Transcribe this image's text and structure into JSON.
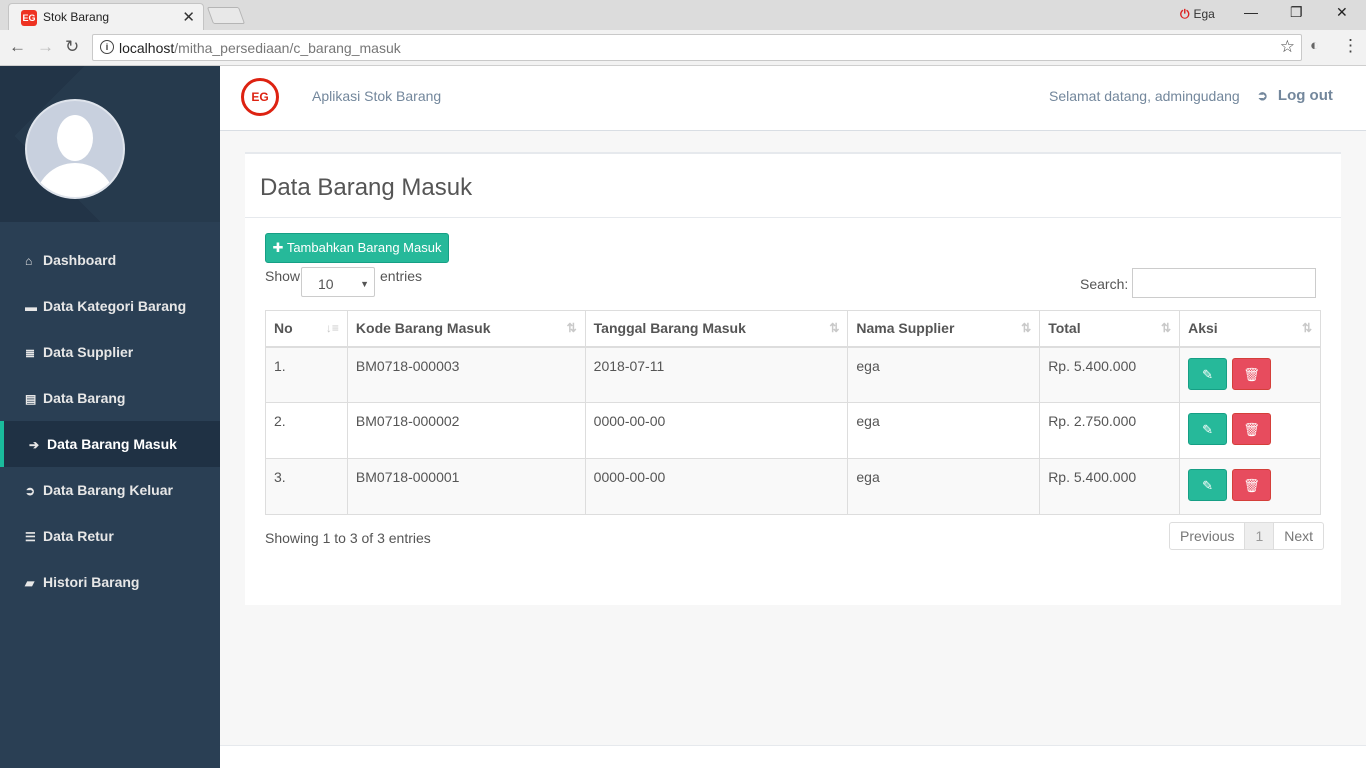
{
  "browser": {
    "tab_title": "Stok Barang",
    "tab_close": "✕",
    "profile_name": "Ega",
    "url_host": "localhost",
    "url_path": "/mitha_persediaan/c_barang_masuk"
  },
  "header": {
    "app_title": "Aplikasi Stok Barang",
    "welcome": "Selamat datang, admingudang",
    "logout_label": "Log out"
  },
  "sidebar": {
    "items": [
      {
        "label": "Dashboard",
        "icon": "home-icon",
        "glyph": "⌂"
      },
      {
        "label": "Data Kategori Barang",
        "icon": "briefcase-icon",
        "glyph": "▬"
      },
      {
        "label": "Data Supplier",
        "icon": "database-icon",
        "glyph": "≣"
      },
      {
        "label": "Data Barang",
        "icon": "file-icon",
        "glyph": "▤"
      },
      {
        "label": "Data Barang Masuk",
        "icon": "sign-in-icon",
        "glyph": "➔"
      },
      {
        "label": "Data Barang Keluar",
        "icon": "sign-out-icon",
        "glyph": "➲"
      },
      {
        "label": "Data Retur",
        "icon": "list-icon",
        "glyph": "☰"
      },
      {
        "label": "Histori Barang",
        "icon": "folder-icon",
        "glyph": "▰"
      }
    ],
    "active_index": 4
  },
  "page": {
    "title": "Data Barang Masuk",
    "add_button": "Tambahkan Barang Masuk",
    "show_label": "Show",
    "entries_label": "entries",
    "page_length": "10",
    "search_label": "Search:",
    "search_value": "",
    "info": "Showing 1 to 3 of 3 entries"
  },
  "table": {
    "columns": [
      "No",
      "Kode Barang Masuk",
      "Tanggal Barang Masuk",
      "Nama Supplier",
      "Total",
      "Aksi"
    ],
    "rows": [
      {
        "no": "1.",
        "kode": "BM0718-000003",
        "tanggal": "2018-07-11",
        "supplier": "ega",
        "total": "Rp. 5.400.000"
      },
      {
        "no": "2.",
        "kode": "BM0718-000002",
        "tanggal": "0000-00-00",
        "supplier": "ega",
        "total": "Rp. 2.750.000"
      },
      {
        "no": "3.",
        "kode": "BM0718-000001",
        "tanggal": "0000-00-00",
        "supplier": "ega",
        "total": "Rp. 5.400.000"
      }
    ]
  },
  "pagination": {
    "previous": "Previous",
    "current": "1",
    "next": "Next"
  },
  "colors": {
    "sidebar_bg": "#2a3f54",
    "accent_green": "#26b99a",
    "delete_red": "#e74c5e"
  }
}
